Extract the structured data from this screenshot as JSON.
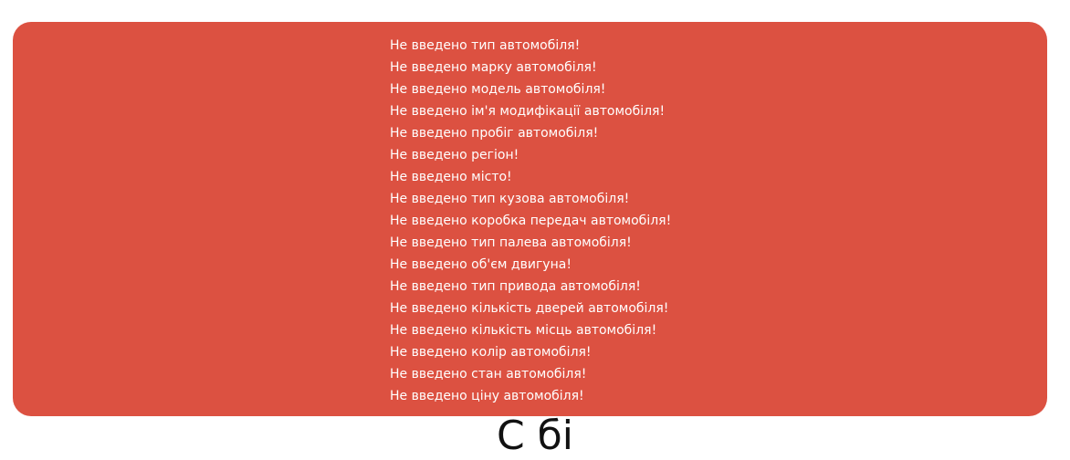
{
  "colors": {
    "panel_background": "#dc5141",
    "error_text": "#ffffff",
    "page_background": "#ffffff"
  },
  "errors": [
    "Не введено тип автомобіля!",
    "Не введено марку автомобіля!",
    "Не введено модель автомобіля!",
    "Не введено ім'я модифікації автомобіля!",
    "Не введено пробіг автомобіля!",
    "Не введено регіон!",
    "Не введено місто!",
    "Не введено тип кузова автомобіля!",
    "Не введено коробка передач автомобіля!",
    "Не введено тип палева автомобіля!",
    "Не введено об'єм двигуна!",
    "Не введено тип привода автомобіля!",
    "Не введено кількість дверей автомобіля!",
    "Не введено кількість місць автомобіля!",
    "Не введено колір автомобіля!",
    "Не введено стан автомобіля!",
    "Не введено ціну автомобіля!"
  ],
  "page_heading": "С                                               бі"
}
